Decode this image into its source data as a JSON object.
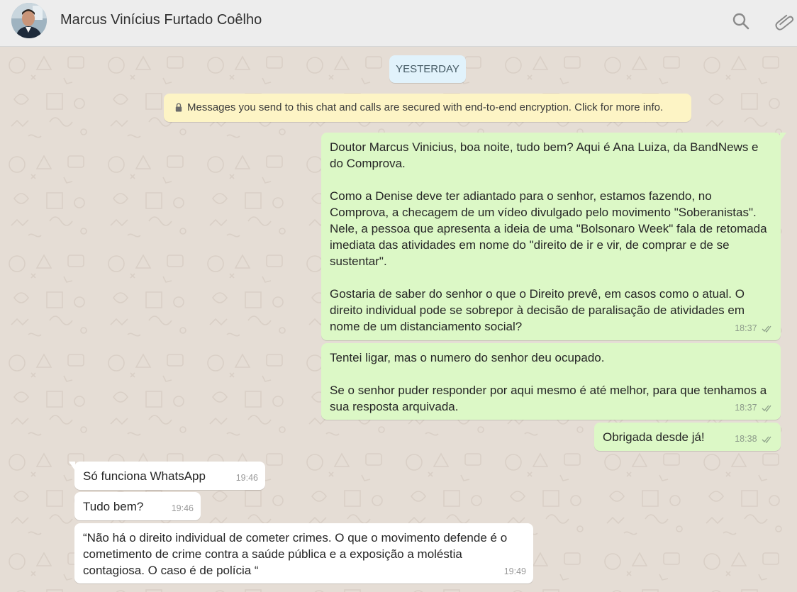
{
  "header": {
    "contact_name": "Marcus Vinícius Furtado Coêlho",
    "icons": [
      "search-icon",
      "attach-icon"
    ]
  },
  "chat": {
    "date_chip": "YESTERDAY",
    "encryption_notice": "Messages you send to this chat and calls are secured with end-to-end encryption. Click for more info.",
    "messages": [
      {
        "direction": "outgoing",
        "text": "Doutor Marcus Vinicius, boa noite, tudo bem? Aqui é Ana Luiza, da BandNews e do Comprova.\n\nComo a Denise deve ter adiantado para o senhor, estamos fazendo, no Comprova, a checagem de um vídeo divulgado pelo movimento \"Soberanistas\". Nele, a pessoa que apresenta a ideia de uma \"Bolsonaro Week\" fala de retomada imediata das atividades em nome do \"direito de ir e vir, de comprar e de se sustentar\".\n\nGostaria de saber do senhor o que o Direito prevê, em casos como o atual. O direito individual pode se sobrepor à decisão de paralisação de atividades em nome de um distanciamento social?",
        "time": "18:37",
        "status": "read"
      },
      {
        "direction": "outgoing",
        "text": "Tentei ligar, mas o numero do senhor deu ocupado.\n\nSe o senhor puder responder por aqui mesmo é até melhor, para que tenhamos a sua resposta arquivada.",
        "time": "18:37",
        "status": "read"
      },
      {
        "direction": "outgoing",
        "text": "Obrigada desde já!",
        "time": "18:38",
        "status": "read"
      },
      {
        "direction": "incoming",
        "text": "Só funciona WhatsApp",
        "time": "19:46"
      },
      {
        "direction": "incoming",
        "text": "Tudo bem?",
        "time": "19:46"
      },
      {
        "direction": "incoming",
        "text": "“Não há o direito individual de cometer crimes. O que o movimento defende é o cometimento de crime contra a saúde pública e a exposição a moléstia contagiosa. O caso é de polícia “",
        "time": "19:49"
      }
    ]
  },
  "colors": {
    "outgoing_bubble": "#dcf8c6",
    "incoming_bubble": "#ffffff",
    "chat_background": "#e5ddd5",
    "header_background": "#ededed",
    "date_chip": "#e1f2fb",
    "encryption_banner": "#fdf4c5"
  }
}
